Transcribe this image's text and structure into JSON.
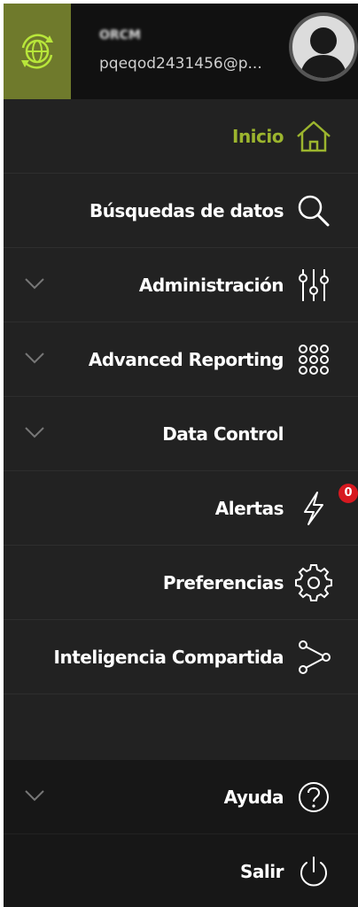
{
  "user": {
    "name": "ORCM",
    "email": "pqeqod2431456@p..."
  },
  "menu": {
    "inicio": "Inicio",
    "busquedas": "Búsquedas de datos",
    "administracion": "Administración",
    "advanced_reporting": "Advanced Reporting",
    "data_control": "Data Control",
    "alertas": "Alertas",
    "alertas_count": "0",
    "preferencias": "Preferencias",
    "inteligencia": "Inteligencia Compartida"
  },
  "footer": {
    "ayuda": "Ayuda",
    "salir": "Salir"
  },
  "colors": {
    "accent": "#9cb52e",
    "logo_bg": "#6f7a2c",
    "badge": "#d71920"
  }
}
